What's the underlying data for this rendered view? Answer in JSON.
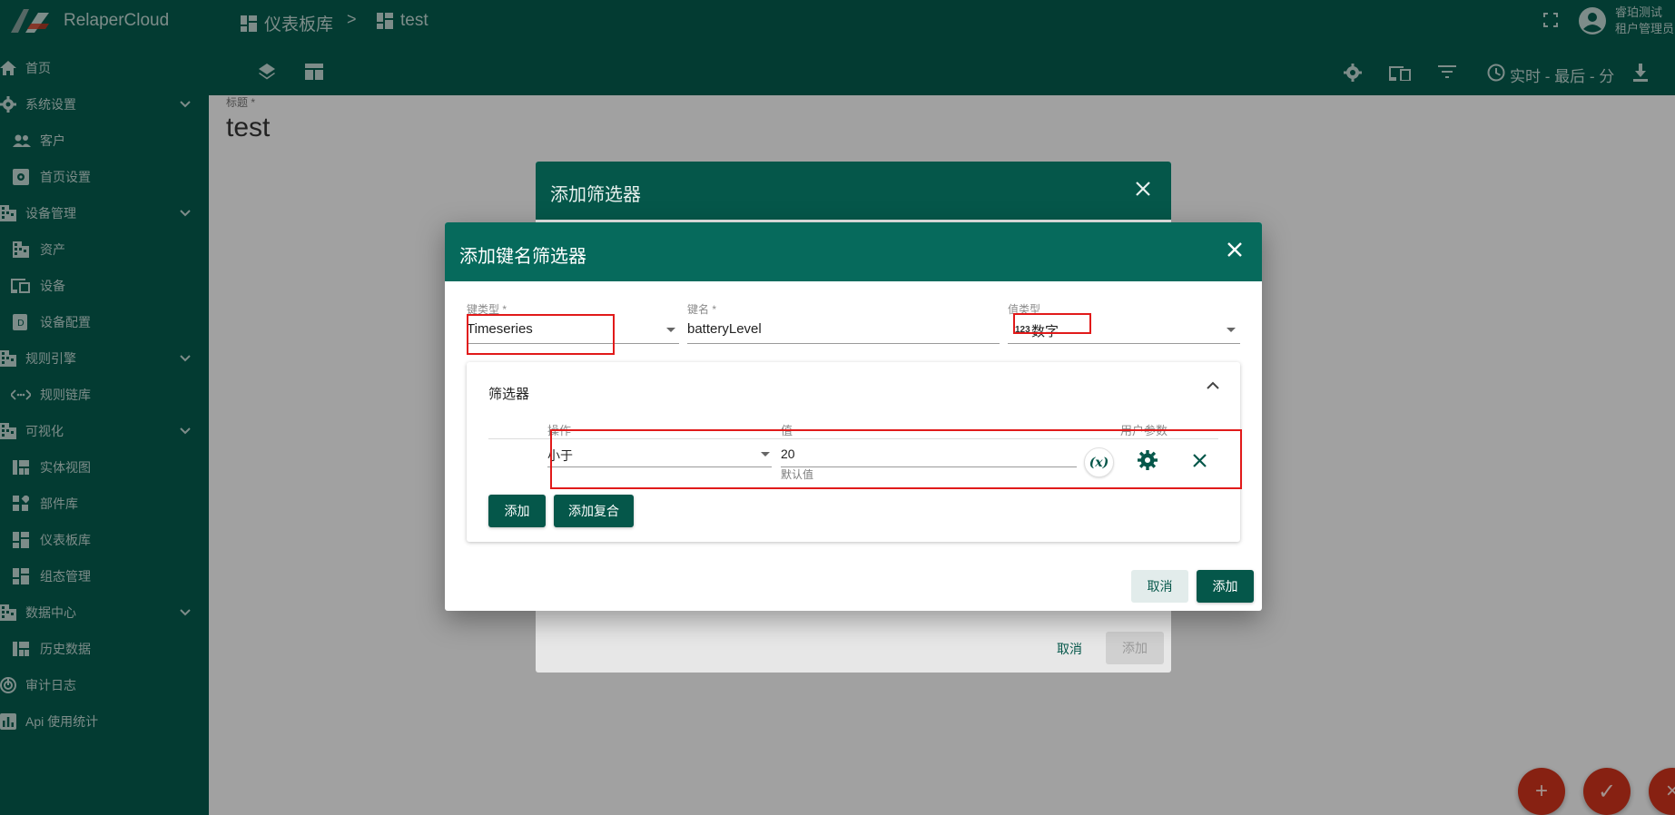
{
  "header": {
    "brand": "RelaperCloud",
    "breadcrumb": [
      {
        "label": "仪表板库"
      },
      {
        "label": "test"
      }
    ],
    "breadcrumb_sep": ">",
    "user": {
      "name": "睿珀测试",
      "role": "租户管理员"
    }
  },
  "toolbar": {
    "realtime_label": "实时 - 最后 - 分"
  },
  "sidebar": {
    "items": [
      {
        "label": "首页"
      },
      {
        "label": "系统设置"
      },
      {
        "label": "客户"
      },
      {
        "label": "首页设置"
      },
      {
        "label": "设备管理"
      },
      {
        "label": "资产"
      },
      {
        "label": "设备"
      },
      {
        "label": "设备配置"
      },
      {
        "label": "规则引擎"
      },
      {
        "label": "规则链库"
      },
      {
        "label": "可视化"
      },
      {
        "label": "实体视图"
      },
      {
        "label": "部件库"
      },
      {
        "label": "仪表板库"
      },
      {
        "label": "组态管理"
      },
      {
        "label": "数据中心"
      },
      {
        "label": "历史数据"
      },
      {
        "label": "审计日志"
      },
      {
        "label": "Api 使用统计"
      }
    ]
  },
  "page": {
    "title_label": "标题 *",
    "title_value": "test"
  },
  "back_dialog": {
    "title": "添加筛选器",
    "cancel": "取消",
    "add": "添加"
  },
  "dialog": {
    "title": "添加键名筛选器",
    "key_type": {
      "label": "键类型 *",
      "value": "Timeseries"
    },
    "key_name": {
      "label": "键名 *",
      "value": "batteryLevel"
    },
    "value_type": {
      "label": "值类型",
      "value": "数字",
      "badge": "123"
    },
    "filters": {
      "title": "筛选器",
      "col_operation": "操作",
      "col_value": "值",
      "col_user_param": "用户参数",
      "operation_value": "小于",
      "value": "20",
      "value_hint": "默认值",
      "var_button": "(x)",
      "add_button": "添加",
      "add_complex_button": "添加复合"
    },
    "cancel": "取消",
    "add": "添加"
  },
  "fabs": [
    "+",
    "✓",
    "×"
  ]
}
